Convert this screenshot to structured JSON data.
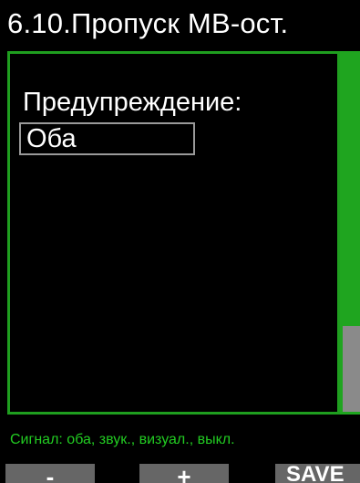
{
  "header": {
    "title": "6.10.Пропуск МВ-ост."
  },
  "setting": {
    "label": "Предупреждение:",
    "value": "Оба"
  },
  "hint": {
    "text": "Сигнал: оба, звук., визуал., выкл."
  },
  "softkeys": {
    "minus": "-",
    "plus": "+",
    "save": "SAVE"
  },
  "colors": {
    "accent_green": "#1f9e1f",
    "hint_green": "#22cc22",
    "softkey_gray": "#666666",
    "scroll_thumb_gray": "#8a8a8a"
  }
}
